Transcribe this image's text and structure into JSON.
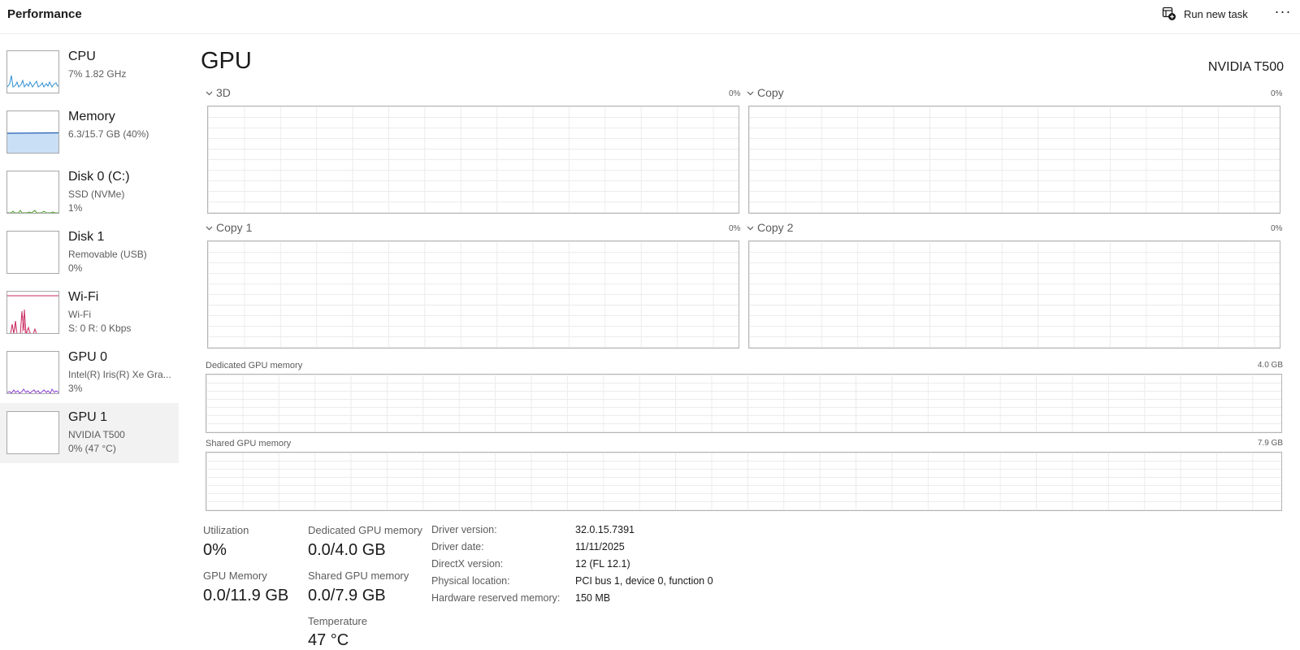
{
  "header": {
    "title": "Performance",
    "run_new_task": "Run new task",
    "more": "···"
  },
  "sidebar": {
    "items": [
      {
        "name": "CPU",
        "sub1": "7%  1.82 GHz",
        "sub2": ""
      },
      {
        "name": "Memory",
        "sub1": "6.3/15.7 GB (40%)",
        "sub2": ""
      },
      {
        "name": "Disk 0 (C:)",
        "sub1": "SSD (NVMe)",
        "sub2": "1%"
      },
      {
        "name": "Disk 1",
        "sub1": "Removable (USB)",
        "sub2": "0%"
      },
      {
        "name": "Wi-Fi",
        "sub1": "Wi-Fi",
        "sub2": "S: 0  R: 0 Kbps"
      },
      {
        "name": "GPU 0",
        "sub1": "Intel(R) Iris(R) Xe Gra...",
        "sub2": "3%"
      },
      {
        "name": "GPU 1",
        "sub1": "NVIDIA T500",
        "sub2": "0% (47 °C)"
      }
    ],
    "selected_index": 6,
    "colors": {
      "cpu": "#2f8fd1",
      "memory": "#1f5fb4",
      "memory_fill": "#c9dff5",
      "disk": "#4c9a2a",
      "wifi": "#c7285f",
      "gpu": "#8a3fd1"
    }
  },
  "main": {
    "title": "GPU",
    "device": "NVIDIA T500",
    "engines": [
      {
        "label": "3D",
        "percent": "0%"
      },
      {
        "label": "Copy",
        "percent": "0%"
      },
      {
        "label": "Copy 1",
        "percent": "0%"
      },
      {
        "label": "Copy 2",
        "percent": "0%"
      }
    ],
    "dedicated_memory": {
      "label": "Dedicated GPU memory",
      "max": "4.0 GB"
    },
    "shared_memory": {
      "label": "Shared GPU memory",
      "max": "7.9 GB"
    }
  },
  "stats": {
    "utilization": {
      "label": "Utilization",
      "value": "0%"
    },
    "dedicated": {
      "label": "Dedicated GPU memory",
      "value": "0.0/4.0 GB"
    },
    "gpu_memory": {
      "label": "GPU Memory",
      "value": "0.0/11.9 GB"
    },
    "shared": {
      "label": "Shared GPU memory",
      "value": "0.0/7.9 GB"
    },
    "temperature": {
      "label": "Temperature",
      "value": "47 °C"
    }
  },
  "info": [
    {
      "key": "Driver version:",
      "value": "32.0.15.7391"
    },
    {
      "key": "Driver date:",
      "value": "11/11/2025"
    },
    {
      "key": "DirectX version:",
      "value": "12 (FL 12.1)"
    },
    {
      "key": "Physical location:",
      "value": "PCI bus 1, device 0, function 0"
    },
    {
      "key": "Hardware reserved memory:",
      "value": "150 MB"
    }
  ]
}
